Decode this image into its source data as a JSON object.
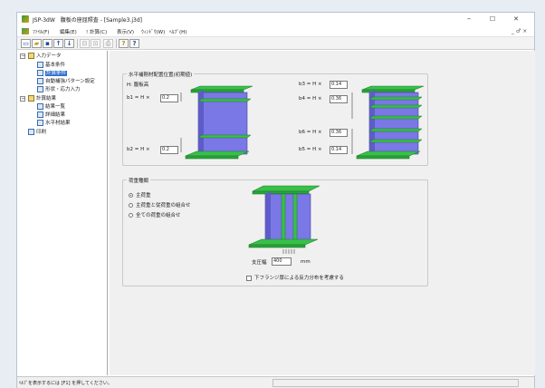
{
  "window": {
    "title": "JSP-3dW　腹板の座屈照査 - [Sample3.j3d]",
    "minimize": "–",
    "maximize": "☐",
    "close": "✕"
  },
  "menu": {
    "items": [
      "ﾌｧｲﾙ(F)",
      "編集(E)",
      "! 計算(C)",
      "表示(V)",
      "ｳｨﾝﾄﾞｳ(W)",
      "ﾍﾙﾌﾟ(H)"
    ],
    "mdi_controls": "_ ♂ ×"
  },
  "toolbar": {
    "new": "▭",
    "open": "▰",
    "save": "▪",
    "up": "↑",
    "down": "↓",
    "copy": "⊟",
    "paste": "⊡",
    "print": "⎙",
    "help": "?",
    "context_help": "?"
  },
  "tree": {
    "input_data": "入力データ",
    "basic": "基本条件",
    "calc_cond": "計算条件",
    "auto_pattern": "自動補強パターン設定",
    "shape_stress": "形状・応力入力",
    "calc_result": "計算結果",
    "result_list": "結果一覧",
    "detail_result": "詳細結果",
    "horizontal_result": "水平材結果",
    "print": "印刷",
    "expand_minus": "−"
  },
  "stiffener_group": {
    "title": "水平補剛材配置位置(初期値)",
    "h_note": "H: 腹板高",
    "b1_label": "b1 = H ×",
    "b1_value": "0.2",
    "b2_label": "b2 = H ×",
    "b2_value": "0.2",
    "b3_label": "b3 = H ×",
    "b3_value": "0.14",
    "b4_label": "b4 = H ×",
    "b4_value": "0.36",
    "b6_label": "b6 = H ×",
    "b6_value": "0.36",
    "b5_label": "b5 = H ×",
    "b5_value": "0.14"
  },
  "load_group": {
    "title": "荷重種類",
    "option_main": "主荷重",
    "option_main_axial": "主荷重と従荷重の組合せ",
    "option_all": "全ての荷重の組合せ",
    "bearing_width_label": "支圧幅",
    "bearing_width_value": "400",
    "bearing_width_unit": "mm",
    "flange_check": "下フランジ厚による反力分布を考慮する"
  },
  "statusbar": {
    "text": "ﾍﾙﾌﾟを表示するには [F1] を押してください。"
  },
  "colors": {
    "web": "#7a77e6",
    "stiffener": "#38c04a",
    "selection": "#2f6fcf"
  }
}
